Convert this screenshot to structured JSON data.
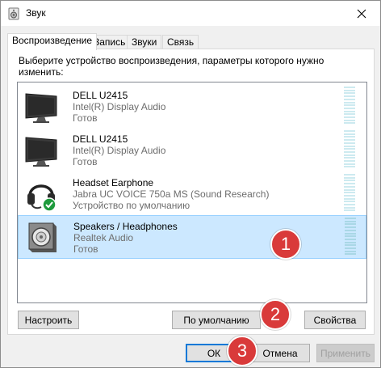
{
  "window": {
    "title": "Звук"
  },
  "tabs": [
    {
      "label": "Воспроизведение",
      "active": true
    },
    {
      "label": "Запись",
      "active": false
    },
    {
      "label": "Звуки",
      "active": false
    },
    {
      "label": "Связь",
      "active": false
    }
  ],
  "instruction": "Выберите устройство воспроизведения, параметры которого нужно изменить:",
  "devices": [
    {
      "name": "DELL U2415",
      "driver": "Intel(R) Display Audio",
      "status": "Готов",
      "icon": "monitor-icon",
      "selected": false
    },
    {
      "name": "DELL U2415",
      "driver": "Intel(R) Display Audio",
      "status": "Готов",
      "icon": "monitor-icon",
      "selected": false
    },
    {
      "name": "Headset Earphone",
      "driver": "Jabra UC VOICE 750a MS (Sound Research)",
      "status": "Устройство по умолчанию",
      "icon": "headset-icon",
      "selected": false,
      "default": true
    },
    {
      "name": "Speakers / Headphones",
      "driver": "Realtek Audio",
      "status": "Готов",
      "icon": "speaker-icon",
      "selected": true
    }
  ],
  "buttons": {
    "configure": "Настроить",
    "set_default": "По умолчанию",
    "properties": "Свойства",
    "ok": "ОК",
    "cancel": "Отмена",
    "apply": "Применить"
  },
  "callouts": [
    "1",
    "2",
    "3"
  ],
  "colors": {
    "selection": "#cce8ff",
    "callout": "#d93a3a",
    "check": "#1e9a3c"
  }
}
